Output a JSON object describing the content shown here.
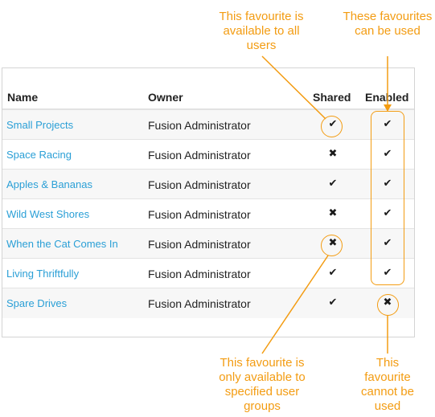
{
  "table": {
    "headers": {
      "name": "Name",
      "owner": "Owner",
      "shared": "Shared",
      "enabled": "Enabled"
    },
    "rows": [
      {
        "name": "Small Projects",
        "owner": "Fusion Administrator",
        "shared": "✔",
        "enabled": "✔"
      },
      {
        "name": "Space Racing",
        "owner": "Fusion Administrator",
        "shared": "✖",
        "enabled": "✔"
      },
      {
        "name": "Apples & Bananas",
        "owner": "Fusion Administrator",
        "shared": "✔",
        "enabled": "✔"
      },
      {
        "name": "Wild West Shores",
        "owner": "Fusion Administrator",
        "shared": "✖",
        "enabled": "✔"
      },
      {
        "name": "When the Cat Comes In",
        "owner": "Fusion Administrator",
        "shared": "✖",
        "enabled": "✔"
      },
      {
        "name": "Living Thriftfully",
        "owner": "Fusion Administrator",
        "shared": "✔",
        "enabled": "✔"
      },
      {
        "name": "Spare Drives",
        "owner": "Fusion Administrator",
        "shared": "✔",
        "enabled": "✖"
      }
    ]
  },
  "callouts": {
    "shared_all": "This favourite is available to all users",
    "enabled_used": "These favourites can be used",
    "shared_groups": "This favourite is only available to specified user groups",
    "not_used": "This favourite cannot be used"
  },
  "colors": {
    "accent": "#f39c12",
    "link": "#2a9fd6"
  }
}
